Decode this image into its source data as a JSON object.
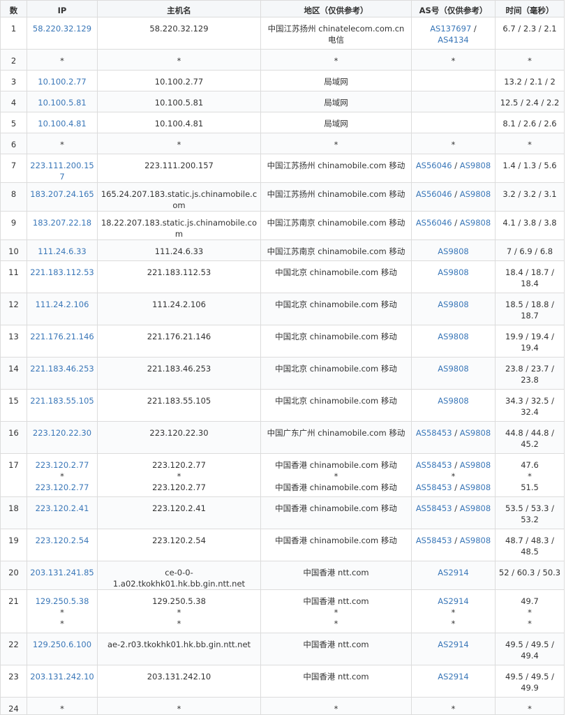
{
  "headers": {
    "num": "数",
    "ip": "IP",
    "host": "主机名",
    "region": "地区（仅供参考）",
    "asn": "AS号（仅供参考）",
    "time": "时间（毫秒）"
  },
  "rows": [
    {
      "num": "1",
      "size": "d",
      "lines": [
        {
          "ip": "58.220.32.129",
          "host": "58.220.32.129",
          "region": "中国江苏扬州 chinatelecom.com.cn 电信",
          "asn": [
            "AS137697",
            "AS4134"
          ],
          "asn_sep": " / "
        }
      ],
      "time": "6.7 / 2.3 / 2.1"
    },
    {
      "num": "2",
      "size": "s",
      "lines": [
        {
          "ip": "*",
          "host": "*",
          "region": "*",
          "asn_text": "*"
        }
      ],
      "time": "*"
    },
    {
      "num": "3",
      "size": "s",
      "lines": [
        {
          "ip": "10.100.2.77",
          "host": "10.100.2.77",
          "region": "局域网",
          "asn_text": ""
        }
      ],
      "time": "13.2 / 2.1 / 2"
    },
    {
      "num": "4",
      "size": "s",
      "lines": [
        {
          "ip": "10.100.5.81",
          "host": "10.100.5.81",
          "region": "局域网",
          "asn_text": ""
        }
      ],
      "time": "12.5 / 2.4 / 2.2"
    },
    {
      "num": "5",
      "size": "s",
      "lines": [
        {
          "ip": "10.100.4.81",
          "host": "10.100.4.81",
          "region": "局域网",
          "asn_text": ""
        }
      ],
      "time": "8.1 / 2.6 / 2.6"
    },
    {
      "num": "6",
      "size": "s",
      "lines": [
        {
          "ip": "*",
          "host": "*",
          "region": "*",
          "asn_text": "*"
        }
      ],
      "time": "*"
    },
    {
      "num": "7",
      "size": "s",
      "lines": [
        {
          "ip": "223.111.200.157",
          "host": "223.111.200.157",
          "region": "中国江苏扬州 chinamobile.com 移动",
          "asn": [
            "AS56046",
            "AS9808"
          ]
        }
      ],
      "time": "1.4 / 1.3 / 5.6"
    },
    {
      "num": "8",
      "size": "s",
      "lines": [
        {
          "ip": "183.207.24.165",
          "host": "165.24.207.183.static.js.chinamobile.com",
          "region": "中国江苏扬州 chinamobile.com 移动",
          "asn": [
            "AS56046",
            "AS9808"
          ]
        }
      ],
      "time": "3.2 / 3.2 / 3.1"
    },
    {
      "num": "9",
      "size": "s",
      "lines": [
        {
          "ip": "183.207.22.18",
          "host": "18.22.207.183.static.js.chinamobile.com",
          "region": "中国江苏南京 chinamobile.com 移动",
          "asn": [
            "AS56046",
            "AS9808"
          ]
        }
      ],
      "time": "4.1 / 3.8 / 3.8"
    },
    {
      "num": "10",
      "size": "s",
      "lines": [
        {
          "ip": "111.24.6.33",
          "host": "111.24.6.33",
          "region": "中国江苏南京 chinamobile.com 移动",
          "asn": [
            "AS9808"
          ]
        }
      ],
      "time": "7 / 6.9 / 6.8"
    },
    {
      "num": "11",
      "size": "d",
      "lines": [
        {
          "ip": "221.183.112.53",
          "host": "221.183.112.53",
          "region": "中国北京 chinamobile.com 移动",
          "asn": [
            "AS9808"
          ]
        }
      ],
      "time": "18.4 / 18.7 / 18.4"
    },
    {
      "num": "12",
      "size": "d",
      "lines": [
        {
          "ip": "111.24.2.106",
          "host": "111.24.2.106",
          "region": "中国北京 chinamobile.com 移动",
          "asn": [
            "AS9808"
          ]
        }
      ],
      "time": "18.5 / 18.8 / 18.7"
    },
    {
      "num": "13",
      "size": "d",
      "lines": [
        {
          "ip": "221.176.21.146",
          "host": "221.176.21.146",
          "region": "中国北京 chinamobile.com 移动",
          "asn": [
            "AS9808"
          ]
        }
      ],
      "time": "19.9 / 19.4 / 19.4"
    },
    {
      "num": "14",
      "size": "d",
      "lines": [
        {
          "ip": "221.183.46.253",
          "host": "221.183.46.253",
          "region": "中国北京 chinamobile.com 移动",
          "asn": [
            "AS9808"
          ]
        }
      ],
      "time": "23.8 / 23.7 / 23.8"
    },
    {
      "num": "15",
      "size": "d",
      "lines": [
        {
          "ip": "221.183.55.105",
          "host": "221.183.55.105",
          "region": "中国北京 chinamobile.com 移动",
          "asn": [
            "AS9808"
          ]
        }
      ],
      "time": "34.3 / 32.5 / 32.4"
    },
    {
      "num": "16",
      "size": "d",
      "lines": [
        {
          "ip": "223.120.22.30",
          "host": "223.120.22.30",
          "region": "中国广东广州 chinamobile.com 移动",
          "asn": [
            "AS58453",
            "AS9808"
          ]
        }
      ],
      "time": "44.8 / 44.8 / 45.2"
    },
    {
      "num": "17",
      "size": "t",
      "lines": [
        {
          "ip": "223.120.2.77",
          "host": "223.120.2.77",
          "region": "中国香港 chinamobile.com 移动",
          "asn": [
            "AS58453",
            "AS9808"
          ],
          "time": "47.6"
        },
        {
          "ip": "*",
          "host": "*",
          "region": "*",
          "asn_text": "*",
          "time": "*"
        },
        {
          "ip": "223.120.2.77",
          "host": "223.120.2.77",
          "region": "中国香港 chinamobile.com 移动",
          "asn": [
            "AS58453",
            "AS9808"
          ],
          "time": "51.5"
        }
      ]
    },
    {
      "num": "18",
      "size": "d",
      "lines": [
        {
          "ip": "223.120.2.41",
          "host": "223.120.2.41",
          "region": "中国香港 chinamobile.com 移动",
          "asn": [
            "AS58453",
            "AS9808"
          ]
        }
      ],
      "time": "53.5 / 53.3 / 53.2"
    },
    {
      "num": "19",
      "size": "d",
      "lines": [
        {
          "ip": "223.120.2.54",
          "host": "223.120.2.54",
          "region": "中国香港 chinamobile.com 移动",
          "asn": [
            "AS58453",
            "AS9808"
          ]
        }
      ],
      "time": "48.7 / 48.3 / 48.5"
    },
    {
      "num": "20",
      "size": "s",
      "lines": [
        {
          "ip": "203.131.241.85",
          "host": "ce-0-0-1.a02.tkokhk01.hk.bb.gin.ntt.net",
          "region": "中国香港 ntt.com",
          "asn": [
            "AS2914"
          ]
        }
      ],
      "time": "52 / 60.3 / 50.3"
    },
    {
      "num": "21",
      "size": "t",
      "lines": [
        {
          "ip": "129.250.5.38",
          "host": "129.250.5.38",
          "region": "中国香港 ntt.com",
          "asn": [
            "AS2914"
          ],
          "time": "49.7"
        },
        {
          "ip": "*",
          "host": "*",
          "region": "*",
          "asn_text": "*",
          "time": "*"
        },
        {
          "ip": "*",
          "host": "*",
          "region": "*",
          "asn_text": "*",
          "time": "*"
        }
      ]
    },
    {
      "num": "22",
      "size": "d",
      "lines": [
        {
          "ip": "129.250.6.100",
          "host": "ae-2.r03.tkokhk01.hk.bb.gin.ntt.net",
          "region": "中国香港 ntt.com",
          "asn": [
            "AS2914"
          ]
        }
      ],
      "time": "49.5 / 49.5 / 49.4"
    },
    {
      "num": "23",
      "size": "d",
      "lines": [
        {
          "ip": "203.131.242.10",
          "host": "203.131.242.10",
          "region": "中国香港 ntt.com",
          "asn": [
            "AS2914"
          ]
        }
      ],
      "time": "49.5 / 49.5 / 49.9"
    },
    {
      "num": "24",
      "size": "last",
      "lines": [
        {
          "ip": "*",
          "host": "*",
          "region": "*",
          "asn_text": "*"
        }
      ],
      "time": "*"
    }
  ]
}
